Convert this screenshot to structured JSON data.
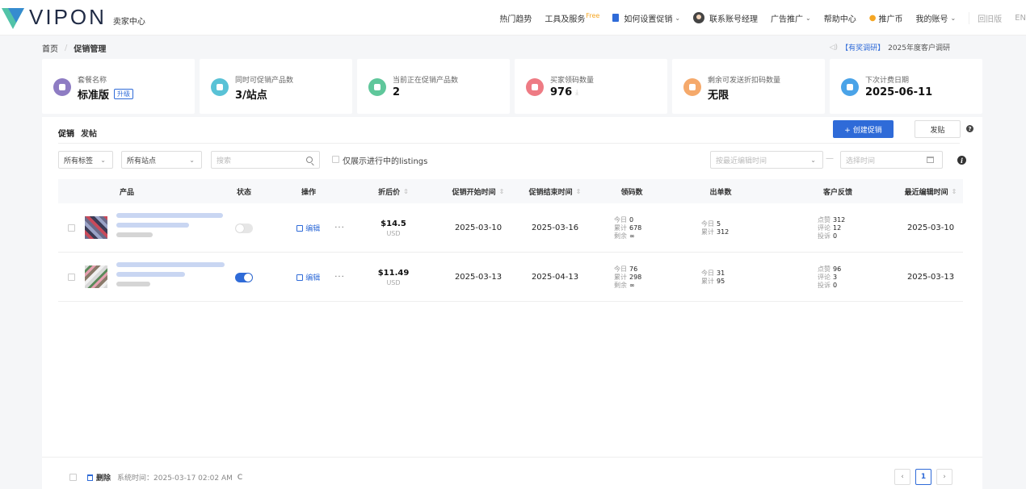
{
  "header": {
    "logo_text": "VIPON",
    "logo_sub": "卖家中心",
    "nav": {
      "trends": "热门趋势",
      "tools": "工具及服务",
      "tools_badge": "Free",
      "howto": "如何设置促销",
      "manager": "联系账号经理",
      "ads": "广告推广",
      "help": "帮助中心",
      "coins": "推广币",
      "account": "我的账号",
      "old": "回旧版",
      "lang": "EN"
    }
  },
  "breadcrumb": {
    "home": "首页",
    "sep": "/",
    "current": "促销管理"
  },
  "survey": {
    "tag": "【有奖调研】",
    "text": "2025年度客户调研"
  },
  "cards": [
    {
      "label": "套餐名称",
      "value": "标准版",
      "extra": "升级",
      "color": "#8e7cc3"
    },
    {
      "label": "同时可促销产品数",
      "value": "3/站点",
      "color": "#59c2d6"
    },
    {
      "label": "当前正在促销产品数",
      "value": "2",
      "color": "#5fc79b"
    },
    {
      "label": "买家领码数量",
      "value": "976",
      "color": "#ee7b84"
    },
    {
      "label": "剩余可发送折扣码数量",
      "value": "无限",
      "color": "#f5a96b"
    },
    {
      "label": "下次计费日期",
      "value": "2025-06-11",
      "color": "#4aa3e8"
    }
  ],
  "tabs": {
    "promo": "促销",
    "post": "发帖"
  },
  "actions": {
    "create": "+ 创建促销",
    "post": "发贴"
  },
  "filters": {
    "tag": "所有标签",
    "site": "所有站点",
    "search_placeholder": "搜索",
    "show_active": "仅展示进行中的listings",
    "sort_placeholder": "按最近编辑时间",
    "dash": "—",
    "date_placeholder": "选择时间"
  },
  "table": {
    "headers": {
      "product": "产品",
      "status": "状态",
      "ops": "操作",
      "price": "折后价",
      "start": "促销开始时间",
      "end": "促销结束时间",
      "codes": "领码数",
      "orders": "出单数",
      "feedback": "客户反馈",
      "edited": "最近编辑时间"
    },
    "edit_label": "编辑",
    "more_label": "···",
    "lbl_today": "今日",
    "lbl_total": "累计",
    "lbl_left": "剩余",
    "lbl_like": "点赞",
    "lbl_review": "评论",
    "lbl_complaint": "投诉",
    "rows": [
      {
        "price": "$14.5",
        "currency": "USD",
        "start": "2025-03-10",
        "end": "2025-03-16",
        "codes_today": "0",
        "codes_total": "678",
        "codes_left": "∞",
        "orders_today": "5",
        "orders_total": "312",
        "likes": "312",
        "reviews": "12",
        "complaints": "0",
        "edited": "2025-03-10"
      },
      {
        "price": "$11.49",
        "currency": "USD",
        "start": "2025-03-13",
        "end": "2025-04-13",
        "codes_today": "76",
        "codes_total": "298",
        "codes_left": "∞",
        "orders_today": "31",
        "orders_total": "95",
        "likes": "96",
        "reviews": "3",
        "complaints": "0",
        "edited": "2025-03-13"
      }
    ]
  },
  "footer": {
    "delete": "删除",
    "system_time": "系统时间：2025-03-17  02:02 AM",
    "refresh": "C",
    "page": "1",
    "prev": "‹",
    "next": "›"
  }
}
